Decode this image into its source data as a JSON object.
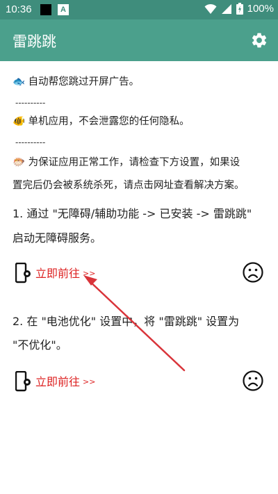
{
  "status_bar": {
    "time": "10:36",
    "notif_icon_letter": "A",
    "battery_text": "100%"
  },
  "app_bar": {
    "title": "雷跳跳",
    "settings_icon": "gear-icon"
  },
  "intro": {
    "line1_emoji": "🐟",
    "line1": "自动帮您跳过开屏广告。",
    "sep1": "----------",
    "line2_emoji": "🐠",
    "line2": "单机应用，不会泄露您的任何隐私。",
    "sep2": "----------",
    "line3_emoji": "🐡",
    "line3a": "为保证应用正常工作，请检查下方设置，如果设",
    "line3b": "置完后仍会被系统杀死，请点击网址查看解决方案。"
  },
  "steps": [
    {
      "text_a": "1. 通过 \"无障碍/辅助功能 -> 已安装 -> 雷跳跳\"",
      "text_b": "启动无障碍服务。",
      "link_label": "立即前往",
      "link_chevron": ">>",
      "status_icon": "sad-face-icon"
    },
    {
      "text_a": "2. 在 \"电池优化\" 设置中，将 \"雷跳跳\" 设置为",
      "text_b": "\"不优化\"。",
      "link_label": "立即前往",
      "link_chevron": ">>",
      "status_icon": "sad-face-icon"
    }
  ],
  "colors": {
    "status_bar": "#3f8d7c",
    "app_bar": "#4ba08c",
    "link": "#dd2222",
    "annotation_arrow": "#d9343a"
  }
}
